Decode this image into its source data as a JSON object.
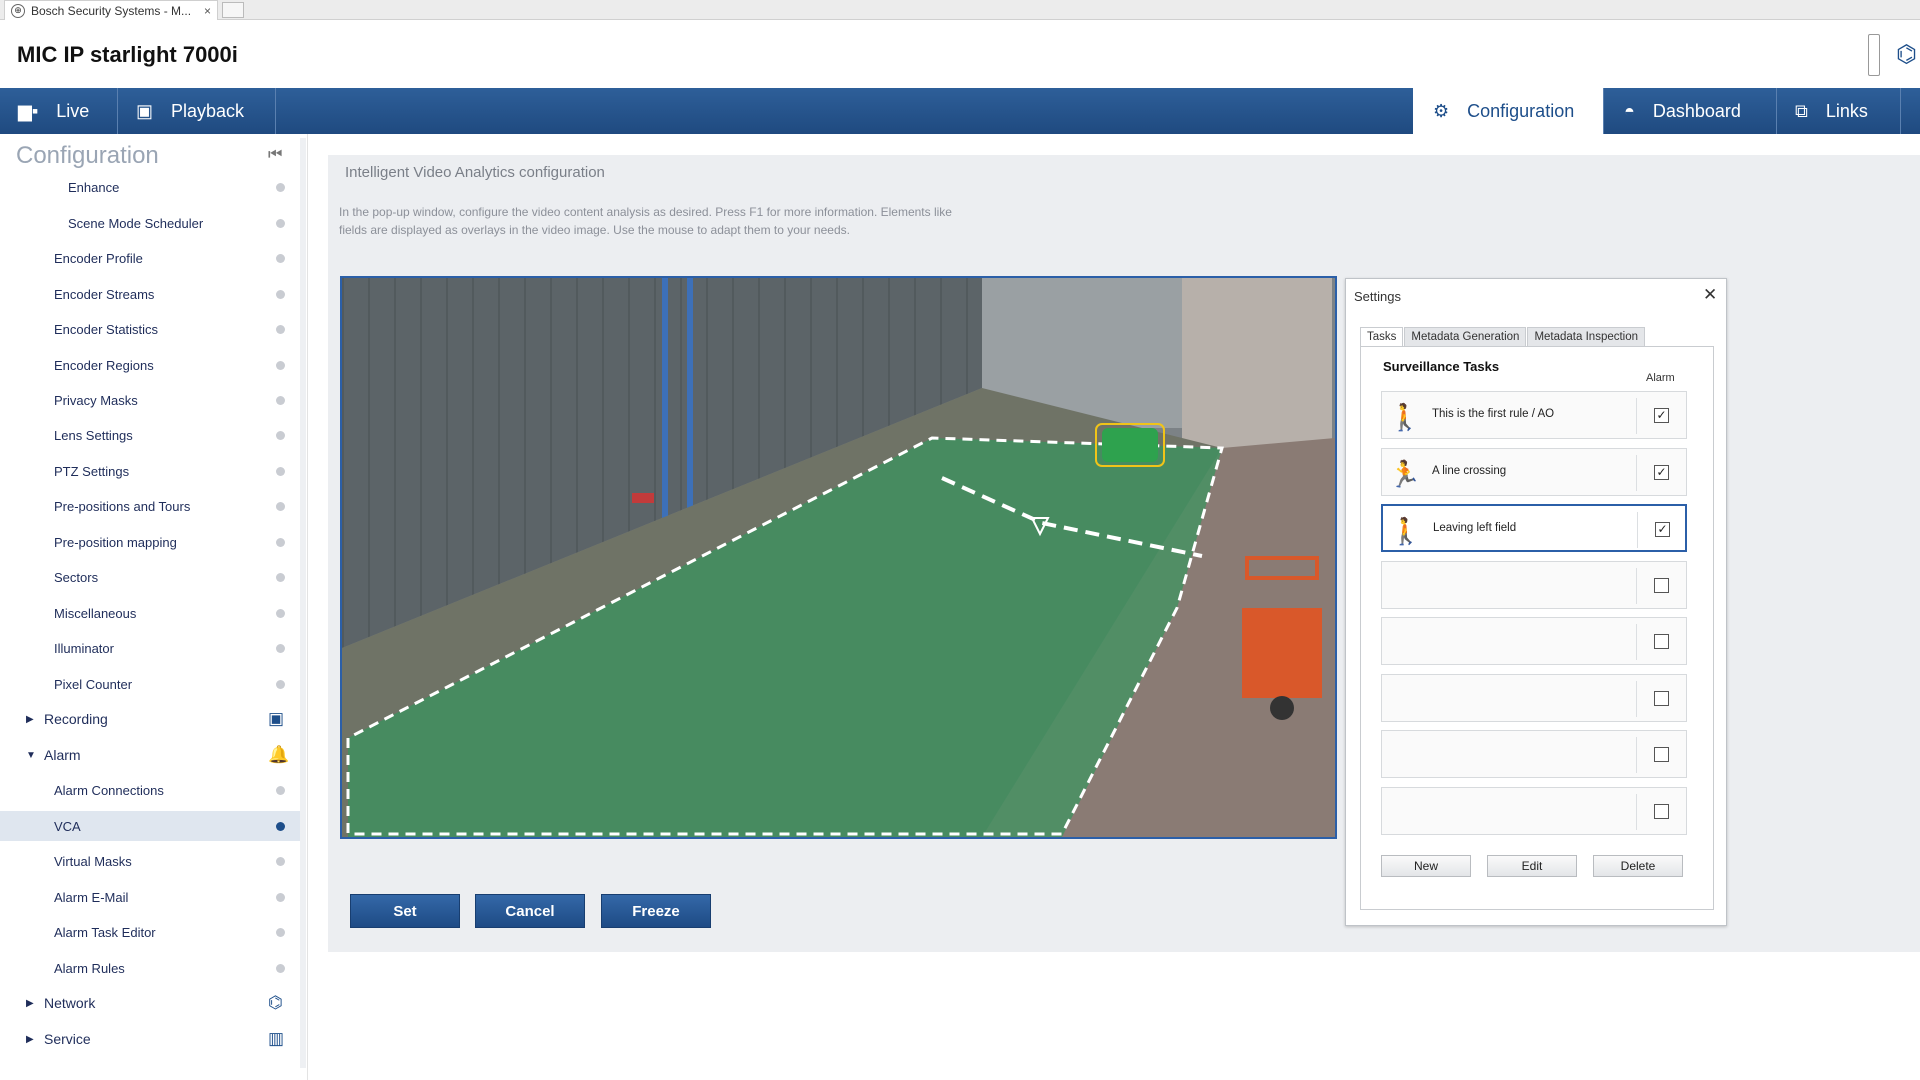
{
  "browser": {
    "tab_title": "Bosch Security Systems - M...",
    "tab_close": "×"
  },
  "header": {
    "device_title": "MIC IP starlight 7000i"
  },
  "nav": {
    "live": "Live",
    "playback": "Playback",
    "configuration": "Configuration",
    "dashboard": "Dashboard",
    "links": "Links"
  },
  "sidebar": {
    "title": "Configuration",
    "items": [
      {
        "label": "Enhance"
      },
      {
        "label": "Scene Mode Scheduler"
      },
      {
        "label": "Encoder Profile"
      },
      {
        "label": "Encoder Streams"
      },
      {
        "label": "Encoder Statistics"
      },
      {
        "label": "Encoder Regions"
      },
      {
        "label": "Privacy Masks"
      },
      {
        "label": "Lens Settings"
      },
      {
        "label": "PTZ Settings"
      },
      {
        "label": "Pre-positions and Tours"
      },
      {
        "label": "Pre-position mapping"
      },
      {
        "label": "Sectors"
      },
      {
        "label": "Miscellaneous"
      },
      {
        "label": "Illuminator"
      },
      {
        "label": "Pixel Counter"
      }
    ],
    "groups": {
      "recording": "Recording",
      "alarm": "Alarm",
      "network": "Network",
      "service": "Service"
    },
    "alarm_items": [
      {
        "label": "Alarm Connections"
      },
      {
        "label": "VCA"
      },
      {
        "label": "Virtual Masks"
      },
      {
        "label": "Alarm E-Mail"
      },
      {
        "label": "Alarm Task Editor"
      },
      {
        "label": "Alarm Rules"
      }
    ],
    "active_item": "VCA"
  },
  "content": {
    "title": "Intelligent Video Analytics configuration",
    "description": "In the pop-up window, configure the video content analysis as desired. Press F1 for more information. Elements like fields are displayed as overlays in the video image. Use the mouse to adapt them to your needs."
  },
  "buttons": {
    "set": "Set",
    "cancel": "Cancel",
    "freeze": "Freeze"
  },
  "settings": {
    "title": "Settings",
    "close": "✕",
    "tabs": [
      "Tasks",
      "Metadata Generation",
      "Metadata Inspection"
    ],
    "selected_tab": "Tasks",
    "section_title": "Surveillance Tasks",
    "alarm_header": "Alarm",
    "tasks": [
      {
        "label": "This is the first rule / AO",
        "alarm": true
      },
      {
        "label": "A line crossing",
        "alarm": true
      },
      {
        "label": "Leaving left field",
        "alarm": true,
        "selected": true
      },
      {
        "label": "",
        "alarm": false
      },
      {
        "label": "",
        "alarm": false
      },
      {
        "label": "",
        "alarm": false
      },
      {
        "label": "",
        "alarm": false
      },
      {
        "label": "",
        "alarm": false
      }
    ],
    "buttons": {
      "new": "New",
      "edit": "Edit",
      "delete": "Delete"
    }
  },
  "colors": {
    "nav_blue": "#1f4a80",
    "accent": "#2b5fa8",
    "field_overlay": "#2f9a5c"
  }
}
